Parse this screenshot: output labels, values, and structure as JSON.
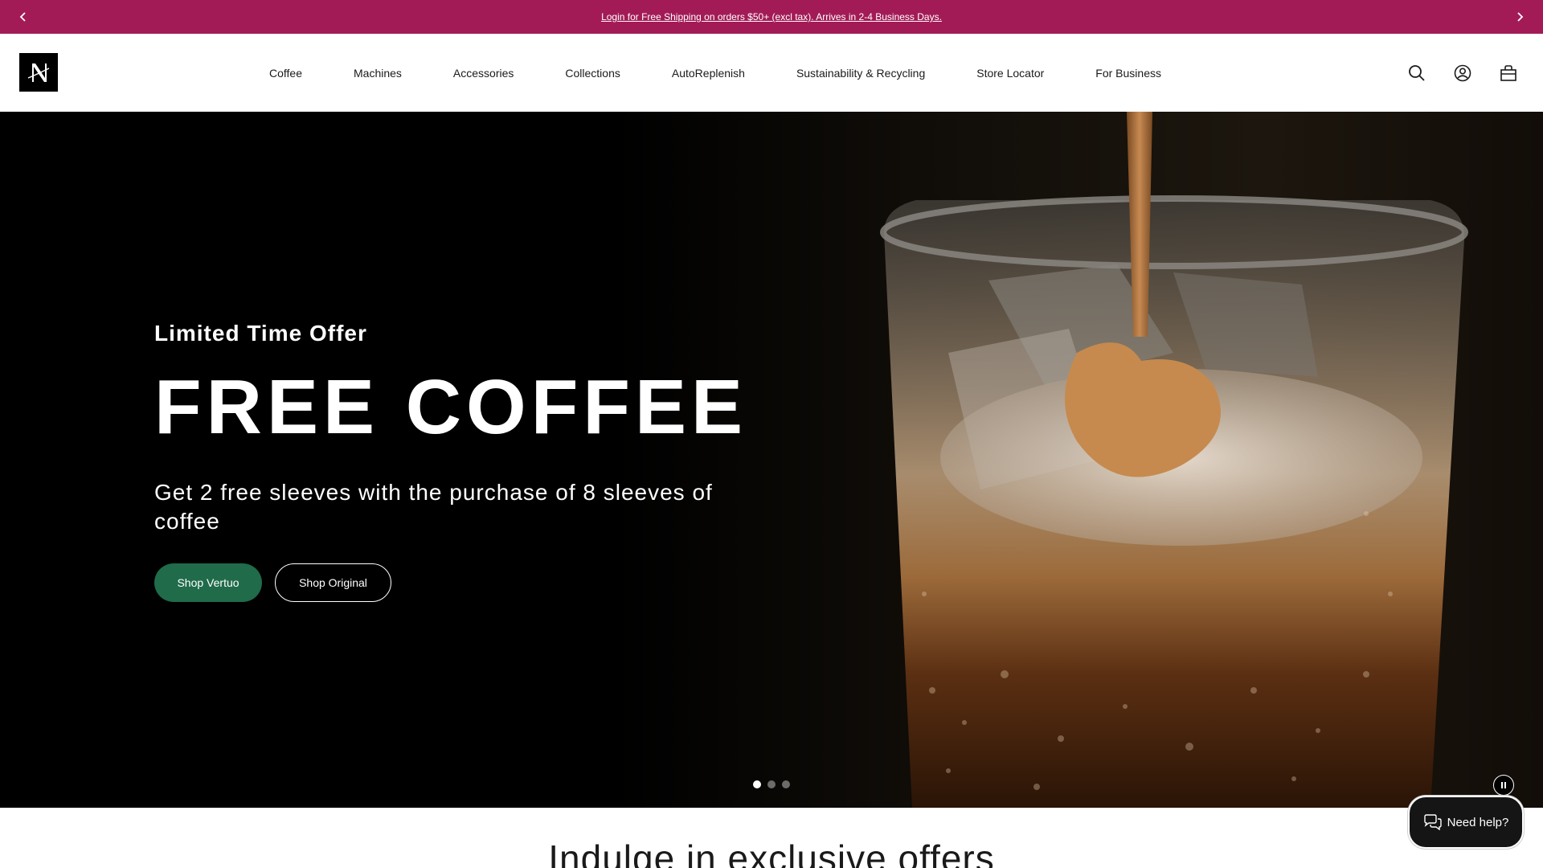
{
  "promo": {
    "text": "Login for Free Shipping on orders $50+ (excl tax). Arrives in 2-4 Business Days.",
    "prev_icon": "chevron-left-icon",
    "next_icon": "chevron-right-icon"
  },
  "header": {
    "logo_letter": "N",
    "nav": [
      {
        "label": "Coffee"
      },
      {
        "label": "Machines"
      },
      {
        "label": "Accessories"
      },
      {
        "label": "Collections"
      },
      {
        "label": "AutoReplenish"
      },
      {
        "label": "Sustainability & Recycling"
      },
      {
        "label": "Store Locator"
      },
      {
        "label": "For Business"
      }
    ],
    "icons": [
      "search-icon",
      "account-icon",
      "bag-icon"
    ]
  },
  "hero": {
    "kicker": "Limited Time Offer",
    "title": "FREE COFFEE",
    "subtitle": "Get 2 free sleeves with the purchase of 8 sleeves of coffee",
    "cta_primary": "Shop Vertuo",
    "cta_secondary": "Shop Original",
    "slides_total": 3,
    "active_slide": 1
  },
  "offers": {
    "heading": "Indulge in exclusive offers"
  },
  "help": {
    "label": "Need help?"
  },
  "colors": {
    "promo_bg": "#a31b56",
    "cta_primary": "#1f6b4a",
    "hero_bg": "#000000"
  }
}
